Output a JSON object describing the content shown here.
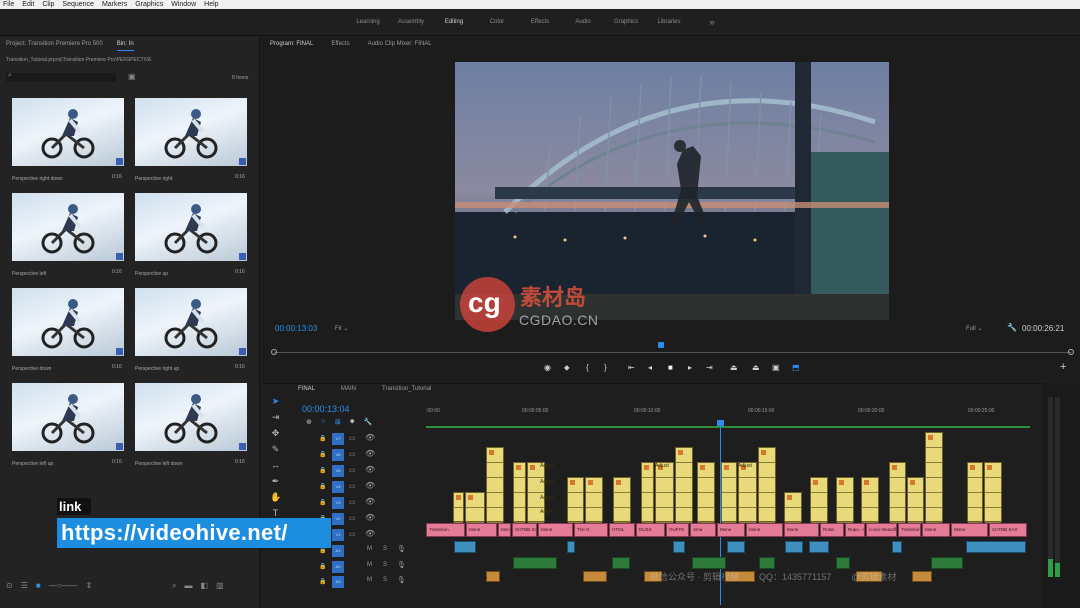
{
  "menu": [
    "File",
    "Edit",
    "Clip",
    "Sequence",
    "Markers",
    "Graphics",
    "Window",
    "Help"
  ],
  "workspaces": [
    "Learning",
    "Assembly",
    "Editing",
    "Color",
    "Effects",
    "Audio",
    "Graphics",
    "Libraries"
  ],
  "workspaces_more": "»",
  "project": {
    "tab_project": "Project: Transition Premiere Pro 500",
    "tab_bin": "Bin: In",
    "path": "Transition_Tutorial.prproj\\Transition Premiere Pro\\PERSPECTIVE",
    "item_count": "8 Items",
    "items": [
      {
        "name": "Perspective right down",
        "dur": "0:16"
      },
      {
        "name": "Perspective right",
        "dur": "0:16"
      },
      {
        "name": "Perspective left",
        "dur": "0:16"
      },
      {
        "name": "Perspective up",
        "dur": "0:16"
      },
      {
        "name": "Perspective down",
        "dur": "0:16"
      },
      {
        "name": "Perspective right up",
        "dur": "0:16"
      },
      {
        "name": "Perspective left up",
        "dur": "0:16"
      },
      {
        "name": "Perspective left down",
        "dur": "0:16"
      }
    ]
  },
  "program": {
    "tab_program": "Program: FINAL",
    "tab_effects": "Effects",
    "tab_audio": "Audio Clip Mixer: FINAL",
    "timecode": "00:00:13:03",
    "fit": "Fit",
    "quality": "Full",
    "duration": "00:00:26:21"
  },
  "watermark": {
    "cg": "cg",
    "cn_name": "素材岛",
    "site": "CGDAO.CN"
  },
  "timeline": {
    "tabs": [
      "FINAL",
      "MAIN",
      "Transition_Tutorial"
    ],
    "timecode": "00:00:13:04",
    "ruler": [
      ":00:00",
      "00:00:05:00",
      "00:00:10:00",
      "00:00:15:00",
      "00:00:20:00",
      "00:00:25:00"
    ],
    "video_tracks": [
      "V8",
      "V7",
      "V6",
      "V5",
      "V4",
      "V3",
      "V2",
      "V1"
    ],
    "audio_tracks": [
      "A1",
      "A2",
      "A3"
    ],
    "pink_labels": [
      "Transition",
      "Mone",
      "Mone",
      "CHTBB SAX",
      "Mone",
      "The O",
      "HTML",
      "DUSS",
      "OUFFE",
      "Sma",
      "Mone",
      "Mone",
      "Mone",
      "Rotat",
      "Rupo - A",
      "Iconic Beautiful"
    ],
    "adjust_labels": [
      "Adjust",
      "Adjust",
      "Adjust",
      "Adjust",
      "Adjust",
      "Adjust"
    ],
    "fx": "fx"
  },
  "overlay": {
    "link_label": "link",
    "url": "https://videohive.net/",
    "bottom_faint": [
      "微信公众号 · 剪辑视频",
      "QQ：1435771157",
      "@剪辑素材"
    ]
  },
  "colors": {
    "accent_blue": "#2d8ceb",
    "video_clip": "#e8d97a",
    "pink_clip": "#e47c97"
  }
}
